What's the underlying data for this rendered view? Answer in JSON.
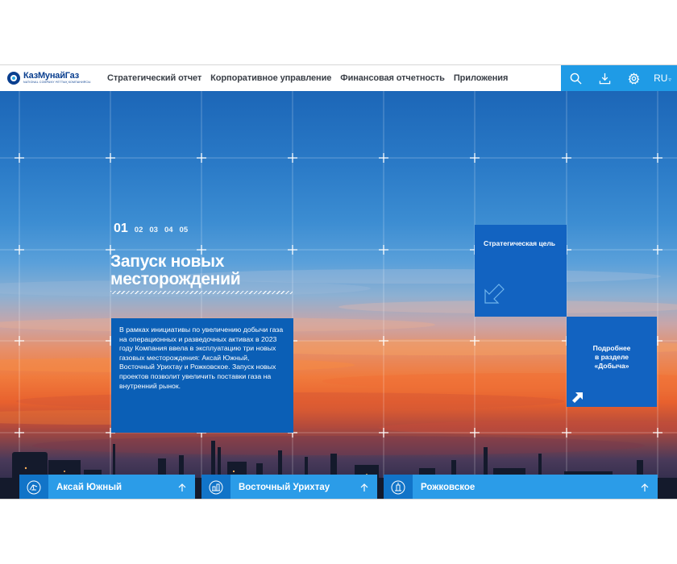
{
  "header": {
    "logo": {
      "name": "КазМунайГаз",
      "subtitle": "NATIONAL COMPANY   ҰЛТТЫҚ КОМПАНИЯСЫ"
    },
    "nav": [
      {
        "label": "Стратегический отчет"
      },
      {
        "label": "Корпоративное управление"
      },
      {
        "label": "Финансовая отчетность"
      },
      {
        "label": "Приложения"
      }
    ],
    "tools": {
      "search_icon": "search-icon",
      "download_icon": "download-icon",
      "settings_icon": "gear-icon",
      "language": "RU",
      "language_chevron": "▿"
    },
    "accent_color": "#1f9be6"
  },
  "hero": {
    "steps": [
      "01",
      "02",
      "03",
      "04",
      "05"
    ],
    "active_step": "01",
    "title_line1": "Запуск новых",
    "title_line2": "месторождений",
    "text": "В рамках инициативы по увеличению добычи газа на операционных и разведочных активах в 2023 году Компания ввела в эксплуатацию три новых газовых месторождения: Аксай Южный, Восточный Урихтау и Рожковское. Запуск новых проектов позволит увеличить поставки газа на внутренний рынок.",
    "goal_label": "Стратегическая цель",
    "more_label_1": "Подробнее",
    "more_label_2": "в разделе",
    "more_label_3": "«Добыча»",
    "box_color": "#1263c1"
  },
  "fields": [
    {
      "name": "Аксай Южный"
    },
    {
      "name": "Восточный Урихтау"
    },
    {
      "name": "Рожковское"
    }
  ]
}
